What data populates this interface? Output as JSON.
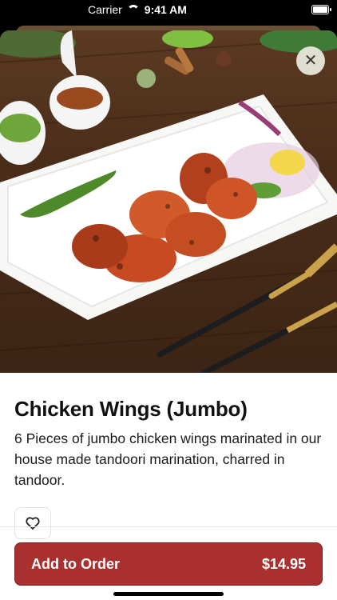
{
  "status_bar": {
    "carrier": "Carrier",
    "time": "9:41 AM"
  },
  "item": {
    "title": "Chicken Wings (Jumbo)",
    "description": "6 Pieces of jumbo chicken wings marinated in our house made tandoori marination, charred in tandoor.",
    "image_alt": "Tandoori chicken wings on a white plate with chutney and salad"
  },
  "close_icon": "close-icon",
  "favorite_icon": "heart-icon",
  "order_button": {
    "label": "Add to Order",
    "price": "$14.95"
  },
  "colors": {
    "accent": "#a9302f",
    "background": "#ffffff"
  }
}
